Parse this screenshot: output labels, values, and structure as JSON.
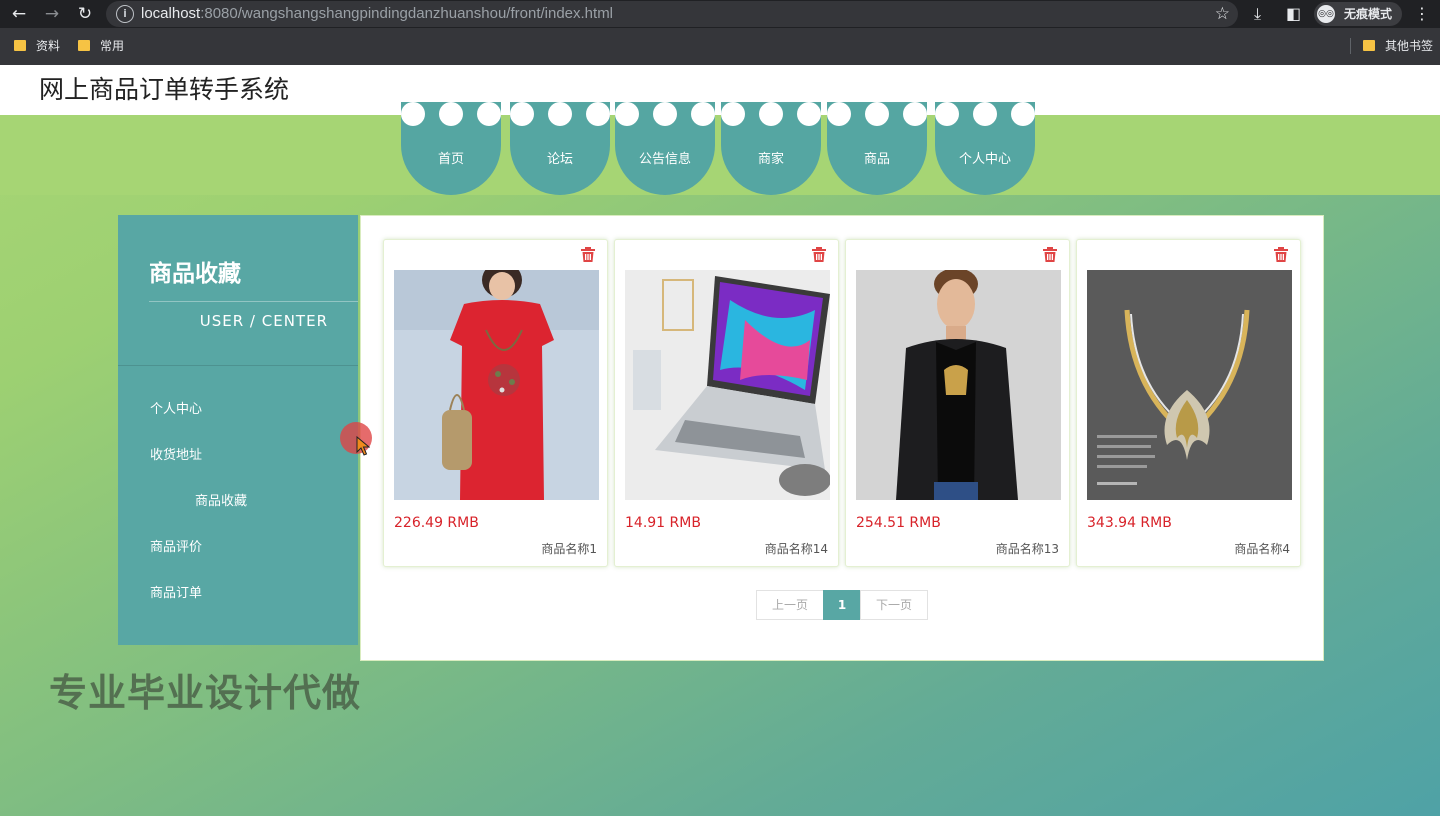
{
  "browser": {
    "url_host": "localhost",
    "url_path": ":8080/wangshangshangpindingdanzhuanshou/front/index.html",
    "incognito_label": "无痕模式",
    "bookmarks": [
      "资料",
      "常用"
    ],
    "other_bookmarks": "其他书签"
  },
  "site": {
    "title": "网上商品订单转手系统"
  },
  "nav": {
    "items": [
      "首页",
      "论坛",
      "公告信息",
      "商家",
      "商品",
      "个人中心"
    ]
  },
  "sidebar": {
    "title": "商品收藏",
    "subtitle": "USER / CENTER",
    "items": [
      "个人中心",
      "收货地址",
      "商品收藏",
      "商品评价",
      "商品订单"
    ],
    "active_index": 2
  },
  "products": [
    {
      "price": "226.49 RMB",
      "name": "商品名称1",
      "image": "red-dress-photo"
    },
    {
      "price": "14.91 RMB",
      "name": "商品名称14",
      "image": "laptop-photo"
    },
    {
      "price": "254.51 RMB",
      "name": "商品名称13",
      "image": "man-jacket-photo"
    },
    {
      "price": "343.94 RMB",
      "name": "商品名称4",
      "image": "necklace-photo"
    }
  ],
  "pagination": {
    "prev": "上一页",
    "current": "1",
    "next": "下一页"
  },
  "watermark": "专业毕业设计代做",
  "colors": {
    "accent": "#58a7a4",
    "background_green": "#a6d574",
    "price_red": "#d8232a"
  }
}
